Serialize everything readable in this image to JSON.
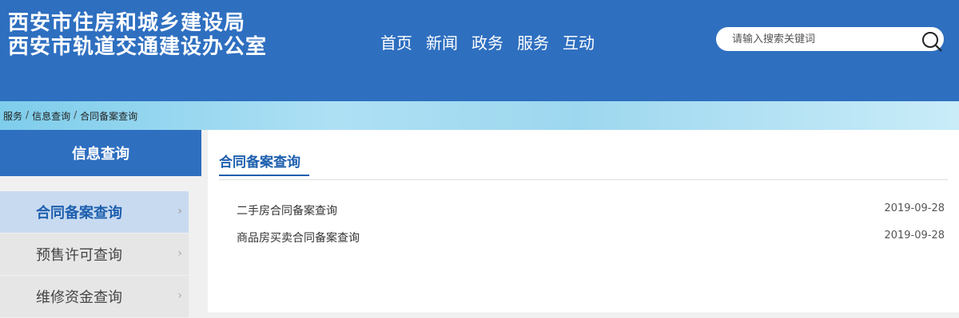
{
  "header": {
    "title_line1": "西安市住房和城乡建设局",
    "title_line2": "西安市轨道交通建设办公室",
    "nav": [
      "首页",
      "新闻",
      "政务",
      "服务",
      "互动"
    ],
    "search_placeholder": "请输入搜索关键词",
    "search_icon": "search-icon"
  },
  "breadcrumb": [
    "服务",
    "信息查询",
    "合同备案查询"
  ],
  "sidebar": {
    "title": "信息查询",
    "items": [
      {
        "label": "合同备案查询",
        "active": true
      },
      {
        "label": "预售许可查询",
        "active": false
      },
      {
        "label": "维修资金查询",
        "active": false
      }
    ]
  },
  "main": {
    "title": "合同备案查询",
    "rows": [
      {
        "label": "二手房合同备案查询",
        "date": "2019-09-28"
      },
      {
        "label": "商品房买卖合同备案查询",
        "date": "2019-09-28"
      }
    ]
  },
  "colors": {
    "primary": "#2e6fc0",
    "accent_text": "#1d5fae",
    "active_bg": "#c8daf0"
  }
}
